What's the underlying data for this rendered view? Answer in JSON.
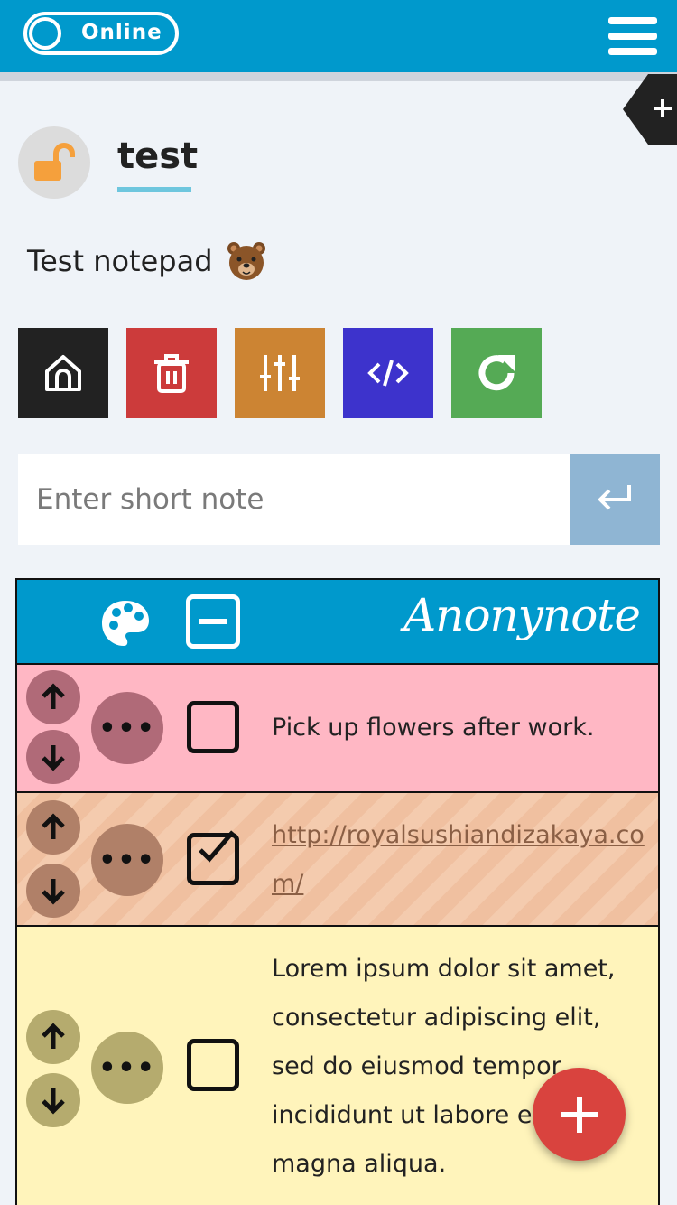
{
  "header": {
    "status_label": "Online",
    "menu_icon": "hamburger-menu-icon",
    "bar_color": "#0099cc"
  },
  "notepad": {
    "title": "test",
    "lock_icon": "unlocked-padlock-icon",
    "description": "Test notepad",
    "description_emoji": "bear-face-icon"
  },
  "toolbar": [
    {
      "icon": "home-icon",
      "color": "#222222"
    },
    {
      "icon": "trash-icon",
      "color": "#cc3b3b"
    },
    {
      "icon": "sliders-icon",
      "color": "#cc8433"
    },
    {
      "icon": "code-icon",
      "color": "#3d33cc"
    },
    {
      "icon": "refresh-icon",
      "color": "#55aa55"
    }
  ],
  "short_note": {
    "placeholder": "Enter short note",
    "value": "",
    "submit_icon": "enter-return-icon"
  },
  "list": {
    "brand": "Anonynote",
    "palette_icon": "palette-icon",
    "collapse_icon": "minus-square-icon",
    "items": [
      {
        "text": "Pick up flowers after work.",
        "checked": false,
        "color": "#ffb7c4",
        "is_link": false
      },
      {
        "text": "http://royalsushiandizakaya.co m/",
        "line1": "http://royalsushiandizakaya.co",
        "line2": "m/",
        "checked": true,
        "color": "#f4cbae",
        "is_link": true
      },
      {
        "lines": [
          "Lorem ipsum dolor sit amet,",
          "consectetur adipiscing elit,",
          "sed do eiusmod tempor",
          "incididunt ut labore et",
          "magna aliqua."
        ],
        "checked": false,
        "color": "#fff4bb",
        "is_link": false
      }
    ]
  },
  "fab": {
    "icon": "plus-icon",
    "color": "#d9433e"
  }
}
